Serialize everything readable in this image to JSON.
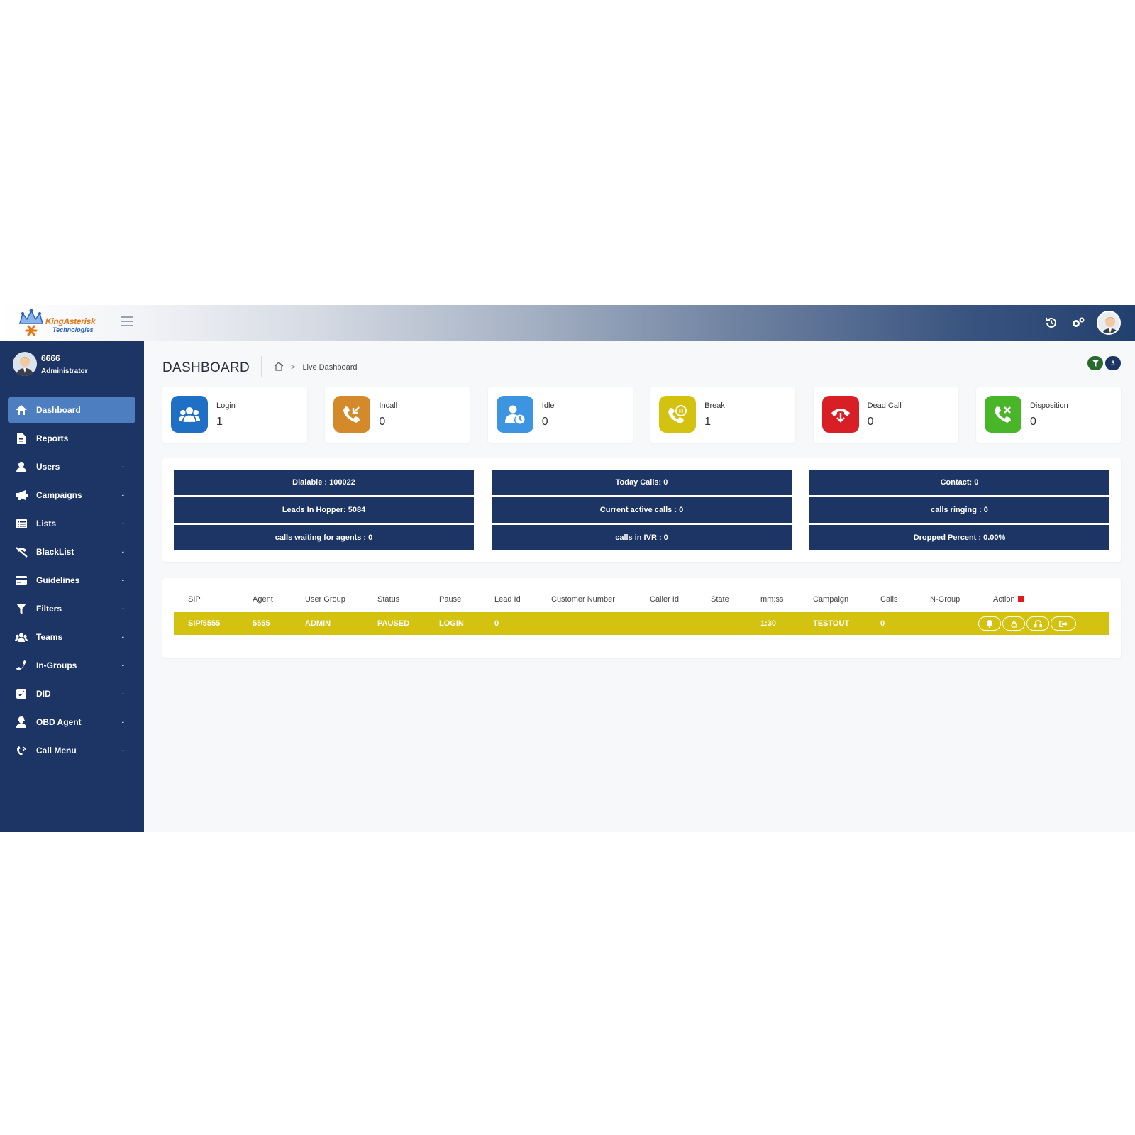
{
  "brand": {
    "name": "KingAsterisk",
    "sub": "Technologies"
  },
  "topbar": {
    "icons": [
      "history-icon",
      "settings-icon",
      "user-avatar"
    ]
  },
  "profile": {
    "name": "6666",
    "role": "Administrator"
  },
  "sidebar": {
    "items": [
      {
        "label": "Dashboard",
        "icon": "home-icon",
        "active": true,
        "has_arrow": false
      },
      {
        "label": "Reports",
        "icon": "file-icon",
        "active": false,
        "has_arrow": false
      },
      {
        "label": "Users",
        "icon": "user-icon",
        "active": false,
        "has_arrow": true
      },
      {
        "label": "Campaigns",
        "icon": "megaphone-icon",
        "active": false,
        "has_arrow": true
      },
      {
        "label": "Lists",
        "icon": "list-icon",
        "active": false,
        "has_arrow": true
      },
      {
        "label": "BlackList",
        "icon": "phone-slash-icon",
        "active": false,
        "has_arrow": true
      },
      {
        "label": "Guidelines",
        "icon": "card-icon",
        "active": false,
        "has_arrow": true
      },
      {
        "label": "Filters",
        "icon": "filter-icon",
        "active": false,
        "has_arrow": true
      },
      {
        "label": "Teams",
        "icon": "users-icon",
        "active": false,
        "has_arrow": true
      },
      {
        "label": "In-Groups",
        "icon": "phone-icon",
        "active": false,
        "has_arrow": true
      },
      {
        "label": "DID",
        "icon": "phone-square-icon",
        "active": false,
        "has_arrow": true
      },
      {
        "label": "OBD Agent",
        "icon": "agent-icon",
        "active": false,
        "has_arrow": true
      },
      {
        "label": "Call Menu",
        "icon": "phone-volume-icon",
        "active": false,
        "has_arrow": true
      }
    ],
    "arrow": "-"
  },
  "page": {
    "title": "DASHBOARD",
    "breadcrumb_sep": ">",
    "breadcrumb_current": "Live Dashboard"
  },
  "filter_badge": {
    "count": "3"
  },
  "cards": [
    {
      "label": "Login",
      "value": "1",
      "color": "#1f6fc5",
      "icon": "users-icon"
    },
    {
      "label": "Incall",
      "value": "0",
      "color": "#d4892a",
      "icon": "incoming-call-icon"
    },
    {
      "label": "Idle",
      "value": "0",
      "color": "#3d94e0",
      "icon": "user-clock-icon"
    },
    {
      "label": "Break",
      "value": "1",
      "color": "#d4c211",
      "icon": "phone-pause-icon"
    },
    {
      "label": "Dead Call",
      "value": "0",
      "color": "#d81f26",
      "icon": "hangup-icon"
    },
    {
      "label": "Disposition",
      "value": "0",
      "color": "#49b528",
      "icon": "phone-x-icon"
    }
  ],
  "summary": [
    [
      "Dialable : 100022",
      "Leads In Hopper: 5084",
      "calls waiting for agents : 0"
    ],
    [
      "Today Calls: 0",
      "Current active calls : 0",
      "calls in IVR : 0"
    ],
    [
      "Contact: 0",
      "calls ringing : 0",
      "Dropped Percent : 0.00%"
    ]
  ],
  "table": {
    "headers": [
      "SIP",
      "Agent",
      "User Group",
      "Status",
      "Pause",
      "Lead Id",
      "Customer Number",
      "Caller Id",
      "State",
      "mm:ss",
      "Campaign",
      "Calls",
      "IN-Group",
      "Action"
    ],
    "rows": [
      [
        "SIP/5555",
        "5555",
        "ADMIN",
        "PAUSED",
        "LOGIN",
        "0",
        "",
        "",
        "",
        "1:30",
        "TESTOUT",
        "0",
        "",
        ""
      ]
    ],
    "row_color": "#d4c211",
    "action_buttons": [
      "bell-icon",
      "recycle-icon",
      "headset-icon",
      "logout-icon"
    ]
  }
}
